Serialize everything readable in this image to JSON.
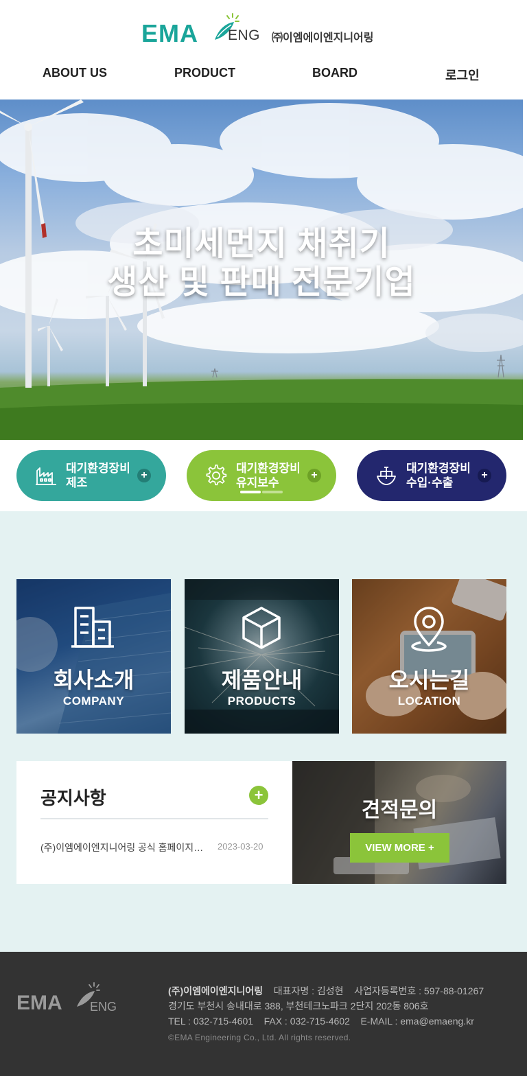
{
  "header": {
    "logo_main": "EMA",
    "logo_eng": "ENG",
    "logo_company": "㈜이엠에이엔지니어링",
    "nav": [
      {
        "label": "ABOUT US"
      },
      {
        "label": "PRODUCT"
      },
      {
        "label": "BOARD"
      },
      {
        "label": "로그인"
      }
    ]
  },
  "hero": {
    "title_line1": "초미세먼지 채취기",
    "title_line2": "생산 및 판매 전문기업"
  },
  "quick_links": [
    {
      "line1": "대기환경장비",
      "line2": "제조",
      "plus": "+",
      "icon": "factory-icon",
      "color": "#34a79c"
    },
    {
      "line1": "대기환경장비",
      "line2": "유지보수",
      "plus": "+",
      "icon": "gear-icon",
      "color": "#8bc43a"
    },
    {
      "line1": "대기환경장비",
      "line2": "수입·수출",
      "plus": "+",
      "icon": "ship-icon",
      "color": "#23276e"
    }
  ],
  "slider": {
    "active_index": 0,
    "count": 2
  },
  "cards": [
    {
      "title": "회사소개",
      "subtitle": "COMPANY",
      "icon": "building-icon"
    },
    {
      "title": "제품안내",
      "subtitle": "PRODUCTS",
      "icon": "box-icon"
    },
    {
      "title": "오시는길",
      "subtitle": "LOCATION",
      "icon": "map-pin-icon"
    }
  ],
  "notice": {
    "title": "공지사항",
    "plus": "+",
    "items": [
      {
        "text": "(주)이엠에이엔지니어링 공식 홈페이지 오픈",
        "date": "2023-03-20"
      }
    ]
  },
  "quote": {
    "title": "견적문의",
    "button": "VIEW MORE +"
  },
  "footer": {
    "logo_main": "EMA",
    "logo_eng": "ENG",
    "company": "(주)이엠에이엔지니어링",
    "ceo": "대표자명 : 김성현",
    "biz_no": "사업자등록번호 : 597-88-01267",
    "address": "경기도 부천시 송내대로 388, 부천테크노파크 2단지 202동 806호",
    "tel": "TEL : 032-715-4601",
    "fax": "FAX : 032-715-4602",
    "email": "E-MAIL : ema@emaeng.kr",
    "copyright": "©EMA Engineering Co., Ltd. All rights reserved."
  },
  "colors": {
    "brand_teal": "#1aa59a",
    "brand_green": "#8bc43a",
    "brand_navy": "#23276e",
    "content_bg": "#e4f2f2",
    "footer_bg": "#333333"
  }
}
